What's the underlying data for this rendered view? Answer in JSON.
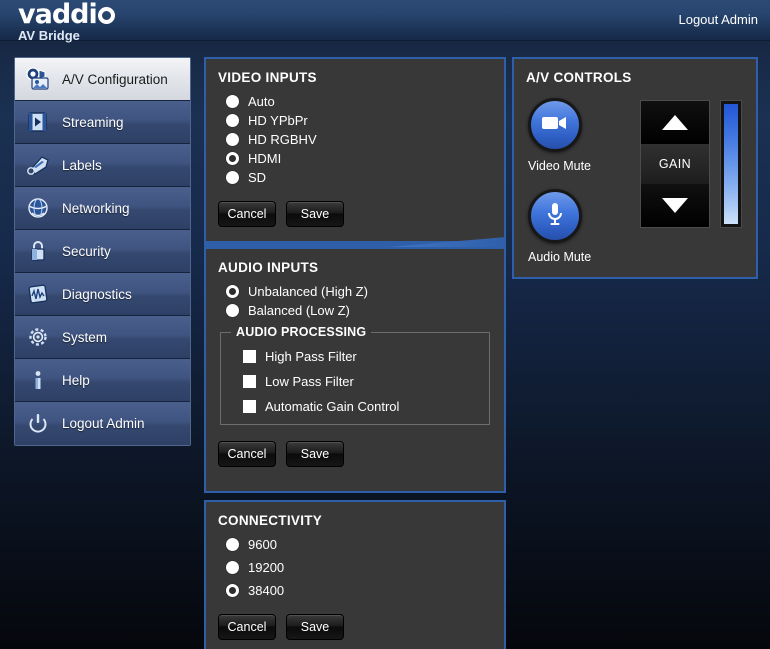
{
  "header": {
    "logo_word": "vaddi",
    "logo_sub": "AV Bridge",
    "logout_label": "Logout Admin"
  },
  "sidebar": {
    "items": [
      {
        "label": "A/V Configuration",
        "icon": "camera-monitor-icon",
        "active": true
      },
      {
        "label": "Streaming",
        "icon": "film-play-icon",
        "active": false
      },
      {
        "label": "Labels",
        "icon": "tag-icon",
        "active": false
      },
      {
        "label": "Networking",
        "icon": "globe-network-icon",
        "active": false
      },
      {
        "label": "Security",
        "icon": "lock-icon",
        "active": false
      },
      {
        "label": "Diagnostics",
        "icon": "waveform-icon",
        "active": false
      },
      {
        "label": "System",
        "icon": "gear-icon",
        "active": false
      },
      {
        "label": "Help",
        "icon": "info-icon",
        "active": false
      },
      {
        "label": "Logout Admin",
        "icon": "power-icon",
        "active": false
      }
    ]
  },
  "video_inputs": {
    "title": "VIDEO INPUTS",
    "options": [
      {
        "label": "Auto",
        "selected": false
      },
      {
        "label": "HD YPbPr",
        "selected": false
      },
      {
        "label": "HD RGBHV",
        "selected": false
      },
      {
        "label": "HDMI",
        "selected": true
      },
      {
        "label": "SD",
        "selected": false
      }
    ],
    "cancel_label": "Cancel",
    "save_label": "Save"
  },
  "audio_inputs": {
    "title": "AUDIO INPUTS",
    "options": [
      {
        "label": "Unbalanced (High Z)",
        "selected": true
      },
      {
        "label": "Balanced (Low Z)",
        "selected": false
      }
    ],
    "processing": {
      "legend": "AUDIO PROCESSING",
      "checkboxes": [
        {
          "label": "High Pass Filter",
          "checked": false
        },
        {
          "label": "Low Pass Filter",
          "checked": false
        },
        {
          "label": "Automatic Gain Control",
          "checked": false
        }
      ]
    },
    "cancel_label": "Cancel",
    "save_label": "Save"
  },
  "connectivity": {
    "title": "CONNECTIVITY",
    "options": [
      {
        "label": "9600",
        "selected": false
      },
      {
        "label": "19200",
        "selected": false
      },
      {
        "label": "38400",
        "selected": true
      }
    ],
    "cancel_label": "Cancel",
    "save_label": "Save"
  },
  "av_controls": {
    "title": "A/V CONTROLS",
    "video_mute_label": "Video Mute",
    "audio_mute_label": "Audio Mute",
    "gain_label": "GAIN",
    "gain_up_icon": "triangle-up-icon",
    "gain_down_icon": "triangle-down-icon",
    "level_meter": "audio-level-meter"
  },
  "colors": {
    "accent_blue": "#2f5fa8",
    "panel_bg": "#383838",
    "sidebar_item": "#3f5480",
    "button_blue": "#4277dd"
  }
}
